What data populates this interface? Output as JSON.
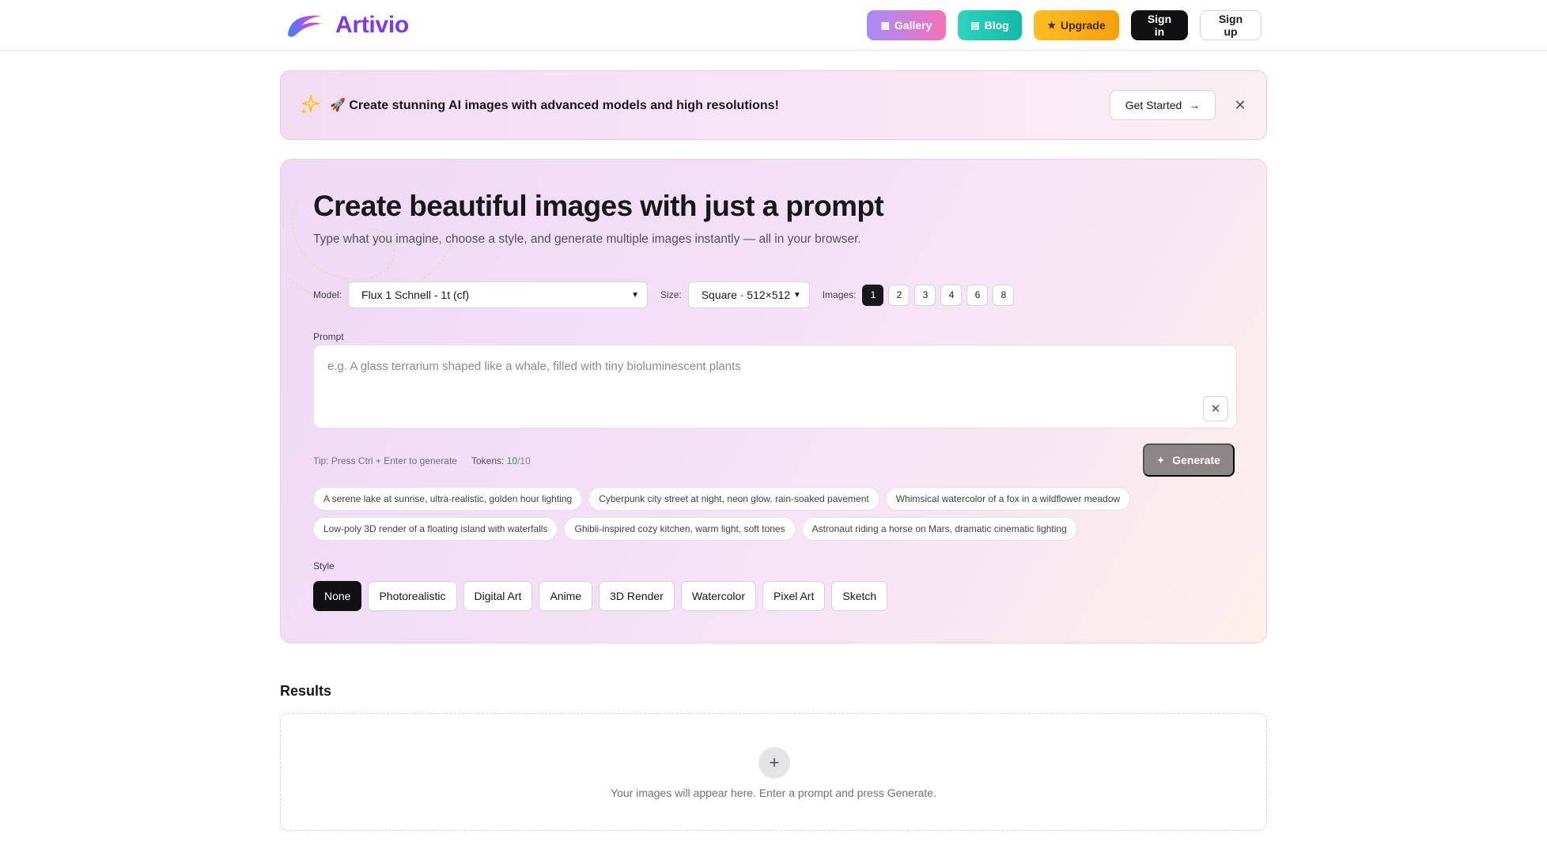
{
  "brand": {
    "name": "Artivio",
    "accent": "#7c3aed"
  },
  "nav": {
    "gallery": "Gallery",
    "blog": "Blog",
    "upgrade": "Upgrade",
    "signin": "Sign in",
    "signup": "Sign up"
  },
  "banner": {
    "text": "🚀 Create stunning AI images with advanced models and high resolutions!",
    "cta": "Get Started",
    "close_icon": "close-icon"
  },
  "hero": {
    "title": "Create beautiful images with just a prompt",
    "subtitle": "Type what you imagine, choose a style, and generate multiple images instantly — all in your browser."
  },
  "controls": {
    "model_label": "Model:",
    "model_value": "Flux 1 Schnell - 1t (cf)",
    "size_label": "Size:",
    "size_value": "Square · 512×512",
    "images_label": "Images:",
    "image_counts": [
      "1",
      "2",
      "3",
      "4",
      "6",
      "8"
    ],
    "selected_count": "1"
  },
  "prompt": {
    "label": "Prompt",
    "placeholder": "e.g. A glass terrarium shaped like a whale, filled with tiny bioluminescent plants",
    "value": ""
  },
  "footer_row": {
    "tip": "Tip: Press Ctrl + Enter to generate",
    "tokens_label": "Tokens:",
    "tokens_used": "10",
    "tokens_total": "/10",
    "generate": "Generate"
  },
  "suggestions": [
    [
      "A serene lake at sunrise, ultra-realistic, golden hour lighting",
      "Cyberpunk city street at night, neon glow, rain-soaked pavement",
      "Whimsical watercolor of a fox in a wildflower meadow"
    ],
    [
      "Low-poly 3D render of a floating island with waterfalls",
      "Ghibli-inspired cozy kitchen, warm light, soft tones",
      "Astronaut riding a horse on Mars, dramatic cinematic lighting"
    ]
  ],
  "style": {
    "label": "Style",
    "options": [
      "None",
      "Photorealistic",
      "Digital Art",
      "Anime",
      "3D Render",
      "Watercolor",
      "Pixel Art",
      "Sketch"
    ],
    "selected": "None"
  },
  "results": {
    "title": "Results",
    "empty": "Your images will appear here. Enter a prompt and press Generate."
  }
}
